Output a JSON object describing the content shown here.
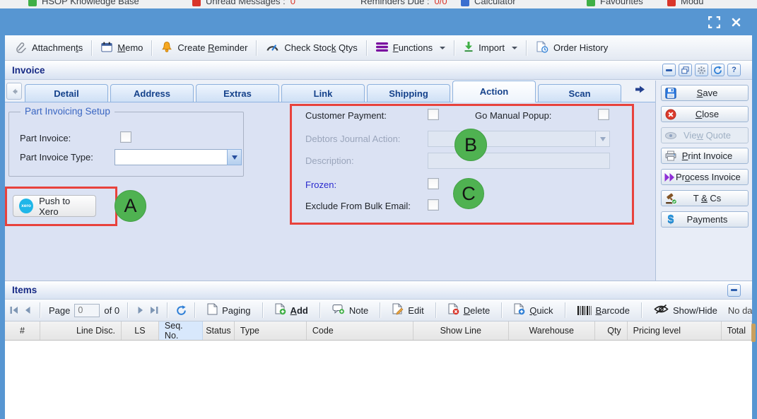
{
  "colors": {
    "titlebar_blue": "#5796d2",
    "annotation_red": "#e8423c",
    "annotation_green": "#4fb251",
    "xero_blue": "#1fb6e8",
    "accent_navy": "#172a85",
    "frozen_label_blue": "#2a2ace"
  },
  "top_strip": {
    "items": [
      {
        "icon": "app-icon",
        "icon_color": "#3faf46",
        "label": "HSOP Knowledge Base",
        "count": "",
        "count_color": ""
      },
      {
        "icon": "mail-icon",
        "icon_color": "#d9352a",
        "label": "Unread Messages : ",
        "count": "0",
        "count_color": "#d9352a"
      },
      {
        "icon": "",
        "icon_color": "",
        "label": "Reminders Due : ",
        "count": "0/0",
        "count_color": "#d9352a"
      },
      {
        "icon": "calculator-icon",
        "icon_color": "#3b6fd0",
        "label": "Calculator",
        "count": "",
        "count_color": ""
      },
      {
        "icon": "favourites-icon",
        "icon_color": "#3faf46",
        "label": "Favourites",
        "count": "",
        "count_color": ""
      },
      {
        "icon": "modules-icon",
        "icon_color": "#d9352a",
        "label": "Modu",
        "count": "",
        "count_color": ""
      }
    ]
  },
  "titlebar": {
    "icons": [
      "fullscreen-icon",
      "close-icon"
    ]
  },
  "toolbar": {
    "buttons": [
      {
        "pre": "Attachmen",
        "key": "t",
        "post": "s"
      },
      {
        "pre": "",
        "key": "M",
        "post": "emo"
      },
      {
        "pre": "Create ",
        "key": "R",
        "post": "eminder"
      },
      {
        "pre": "Check Stoc",
        "key": "k",
        "post": " Qtys"
      },
      {
        "pre": "",
        "key": "F",
        "post": "unctions"
      },
      {
        "pre": "Import",
        "key": "",
        "post": ""
      },
      {
        "pre": "Order History",
        "key": "",
        "post": ""
      }
    ]
  },
  "invoice_panel": {
    "title": "Invoice",
    "window_buttons": [
      "minimize-icon",
      "restore-icon",
      "settings-icon",
      "refresh-icon",
      "help-icon"
    ]
  },
  "tabs": {
    "labels": [
      "Detail",
      "Address",
      "Extras",
      "Link",
      "Shipping",
      "Action",
      "Scan"
    ],
    "active": "Action"
  },
  "side_buttons": [
    {
      "pre": "",
      "key": "S",
      "post": "ave",
      "disabled": false
    },
    {
      "pre": "",
      "key": "C",
      "post": "lose",
      "disabled": false
    },
    {
      "pre": "Vie",
      "key": "w",
      "post": " Quote",
      "disabled": true
    },
    {
      "pre": "",
      "key": "P",
      "post": "rint Invoice",
      "disabled": false
    },
    {
      "pre": "Pr",
      "key": "o",
      "post": "cess Invoice",
      "disabled": false
    },
    {
      "pre": "T ",
      "key": "&",
      "post": " Cs",
      "disabled": false
    },
    {
      "pre": "Payments",
      "key": "",
      "post": "",
      "disabled": false
    }
  ],
  "part_invoicing": {
    "legend": "Part Invoicing Setup",
    "part_invoice_label": "Part Invoice:",
    "part_invoice_type_label": "Part Invoice Type:"
  },
  "xero": {
    "button_label": "Push to Xero",
    "badge": "xero"
  },
  "action_section": {
    "customer_payment_label": "Customer Payment:",
    "go_manual_popup_label": "Go Manual Popup:",
    "debtors_journal_action_label": "Debtors Journal Action:",
    "description_label": "Description:",
    "frozen_label": "Frozen:",
    "exclude_bulk_email_label": "Exclude From Bulk Email:"
  },
  "annotations": {
    "a": "A",
    "b": "B",
    "c": "C"
  },
  "items_panel": {
    "title": "Items",
    "pager": {
      "page_label": "Page",
      "page_value": "0",
      "of_label": "of 0"
    },
    "buttons": [
      {
        "pre": "Paging",
        "key": "",
        "post": ""
      },
      {
        "pre": "",
        "key": "A",
        "post": "dd",
        "bold": true
      },
      {
        "pre": "Note",
        "key": "",
        "post": ""
      },
      {
        "pre": "Edit",
        "key": "",
        "post": ""
      },
      {
        "pre": "",
        "key": "D",
        "post": "elete"
      },
      {
        "pre": "",
        "key": "Q",
        "post": "uick"
      },
      {
        "pre": "",
        "key": "B",
        "post": "arcode"
      },
      {
        "pre": "Show/Hide",
        "key": "",
        "post": ""
      }
    ],
    "empty_text": "No data to disp",
    "columns": [
      "#",
      "Line Disc.",
      "LS",
      "Seq. No.",
      "Status",
      "Type",
      "Code",
      "Show Line",
      "Warehouse",
      "Qty",
      "Pricing level",
      "Total"
    ]
  }
}
